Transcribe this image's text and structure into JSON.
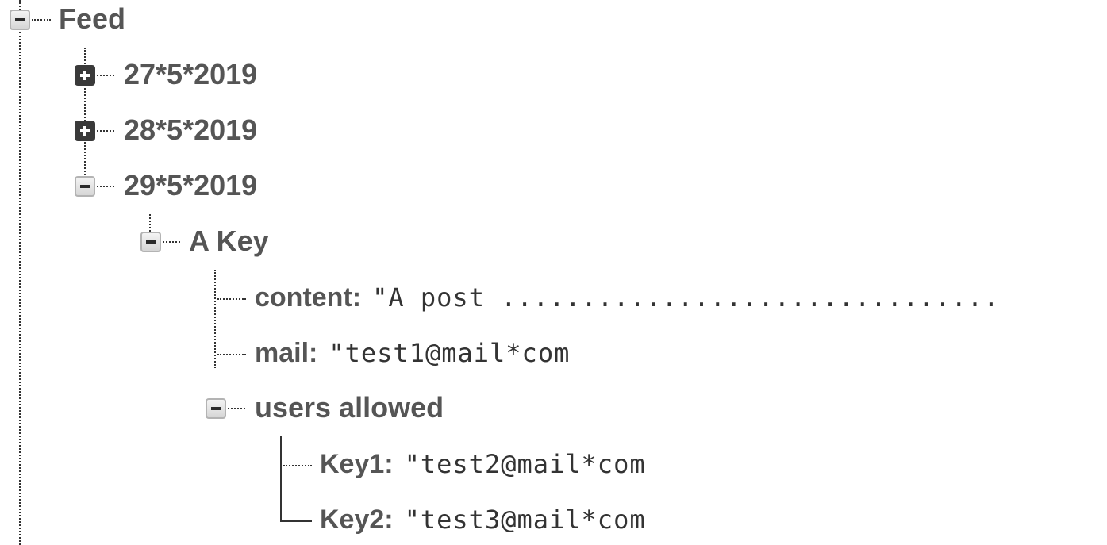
{
  "tree": {
    "root": {
      "label": "Feed",
      "state": "expanded"
    },
    "dates": [
      {
        "label": "27*5*2019",
        "state": "collapsed"
      },
      {
        "label": "28*5*2019",
        "state": "collapsed"
      },
      {
        "label": "29*5*2019",
        "state": "expanded"
      }
    ],
    "key_node": {
      "label": "A Key",
      "state": "expanded"
    },
    "fields": {
      "content": {
        "key": "content:",
        "value": "\"A post ..............................."
      },
      "mail": {
        "key": "mail:",
        "value": "\"test1@mail*com"
      },
      "users_allowed": {
        "label": "users allowed",
        "state": "expanded"
      }
    },
    "users": [
      {
        "key": "Key1:",
        "value": "\"test2@mail*com"
      },
      {
        "key": "Key2:",
        "value": "\"test3@mail*com"
      }
    ]
  }
}
